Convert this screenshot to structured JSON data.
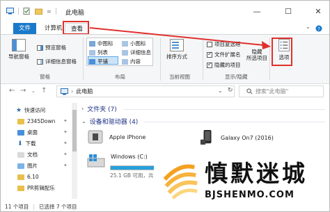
{
  "window": {
    "title": "此电脑",
    "qat_separator": "=",
    "minimize": "—",
    "maximize": "☐",
    "close": "✕"
  },
  "ribbon_tabs": [
    {
      "label": "文件"
    },
    {
      "label": "计算机"
    },
    {
      "label": "查看"
    }
  ],
  "ribbon": {
    "panes": {
      "nav_pane": "导航窗格",
      "preview_pane": "预览窗格",
      "details_pane": "详细信息窗格",
      "group": "窗格"
    },
    "layout": {
      "items": [
        "中图标",
        "小图标",
        "列表",
        "详细信息",
        "平铺",
        "内容"
      ],
      "selected": "平铺",
      "group": "布局"
    },
    "current_view": {
      "sort_by": "排序方式",
      "group": "当前视图"
    },
    "show_hide": {
      "item_checkboxes": "项目复选框",
      "file_extensions": "文件扩展名",
      "hidden_items": "隐藏的项目",
      "hide_selected": "隐藏\n所选项目",
      "group": "显示/隐藏"
    },
    "options": "选项"
  },
  "address": {
    "path": "此电脑",
    "search_placeholder": "搜索\"此电脑\""
  },
  "nav_pane": {
    "quick_access": "快速访问",
    "items": [
      "2345Down",
      "桌面",
      "下载",
      "文档",
      "图片",
      "6.10",
      "PR剪辑配乐"
    ]
  },
  "content": {
    "folders_section": "文件夹 (7)",
    "devices_section": "设备和驱动器 (4)",
    "devices": [
      {
        "name": "Apple iPhone"
      },
      {
        "name": "Galaxy On7 (2016)"
      },
      {
        "name": "Windows (C:)",
        "free_text": "25.1 GB 可用，共 59.1 GB",
        "used_fraction": 0.575
      }
    ]
  },
  "status_bar": {
    "count": "11 个项目",
    "selected": "已选择 7 个项目"
  },
  "watermark": {
    "chinese": "慎默迷城",
    "english": "BJSHENMO.COM"
  },
  "colors": {
    "accent": "#1979ca",
    "highlight": "#e0302c",
    "drive_fill": "#26a0da"
  }
}
